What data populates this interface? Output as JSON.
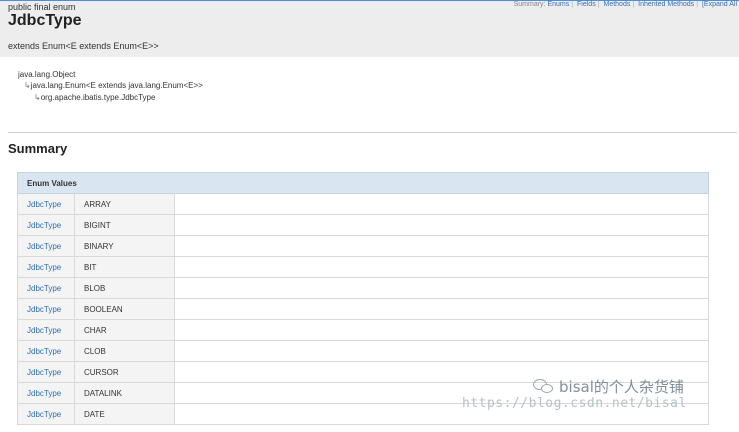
{
  "header": {
    "modifiers": "public final enum",
    "title": "JdbcType",
    "extends": "extends Enum<E extends Enum<E>>"
  },
  "summary_nav": {
    "label": "Summary:",
    "links": [
      "Enums",
      "Fields",
      "Methods",
      "Inherited Methods",
      "[Expand All"
    ]
  },
  "inheritance": [
    "java.lang.Object",
    "java.lang.Enum<E extends java.lang.Enum<E>>",
    "org.apache.ibatis.type.JdbcType"
  ],
  "section": {
    "summary_title": "Summary"
  },
  "enum_table": {
    "header": "Enum Values",
    "rows": [
      {
        "type": "JdbcType",
        "name": "ARRAY"
      },
      {
        "type": "JdbcType",
        "name": "BIGINT"
      },
      {
        "type": "JdbcType",
        "name": "BINARY"
      },
      {
        "type": "JdbcType",
        "name": "BIT"
      },
      {
        "type": "JdbcType",
        "name": "BLOB"
      },
      {
        "type": "JdbcType",
        "name": "BOOLEAN"
      },
      {
        "type": "JdbcType",
        "name": "CHAR"
      },
      {
        "type": "JdbcType",
        "name": "CLOB"
      },
      {
        "type": "JdbcType",
        "name": "CURSOR"
      },
      {
        "type": "JdbcType",
        "name": "DATALINK"
      },
      {
        "type": "JdbcType",
        "name": "DATE"
      }
    ]
  },
  "watermark": {
    "text": "bisal的个人杂货铺",
    "url": "https://blog.csdn.net/bisal"
  }
}
